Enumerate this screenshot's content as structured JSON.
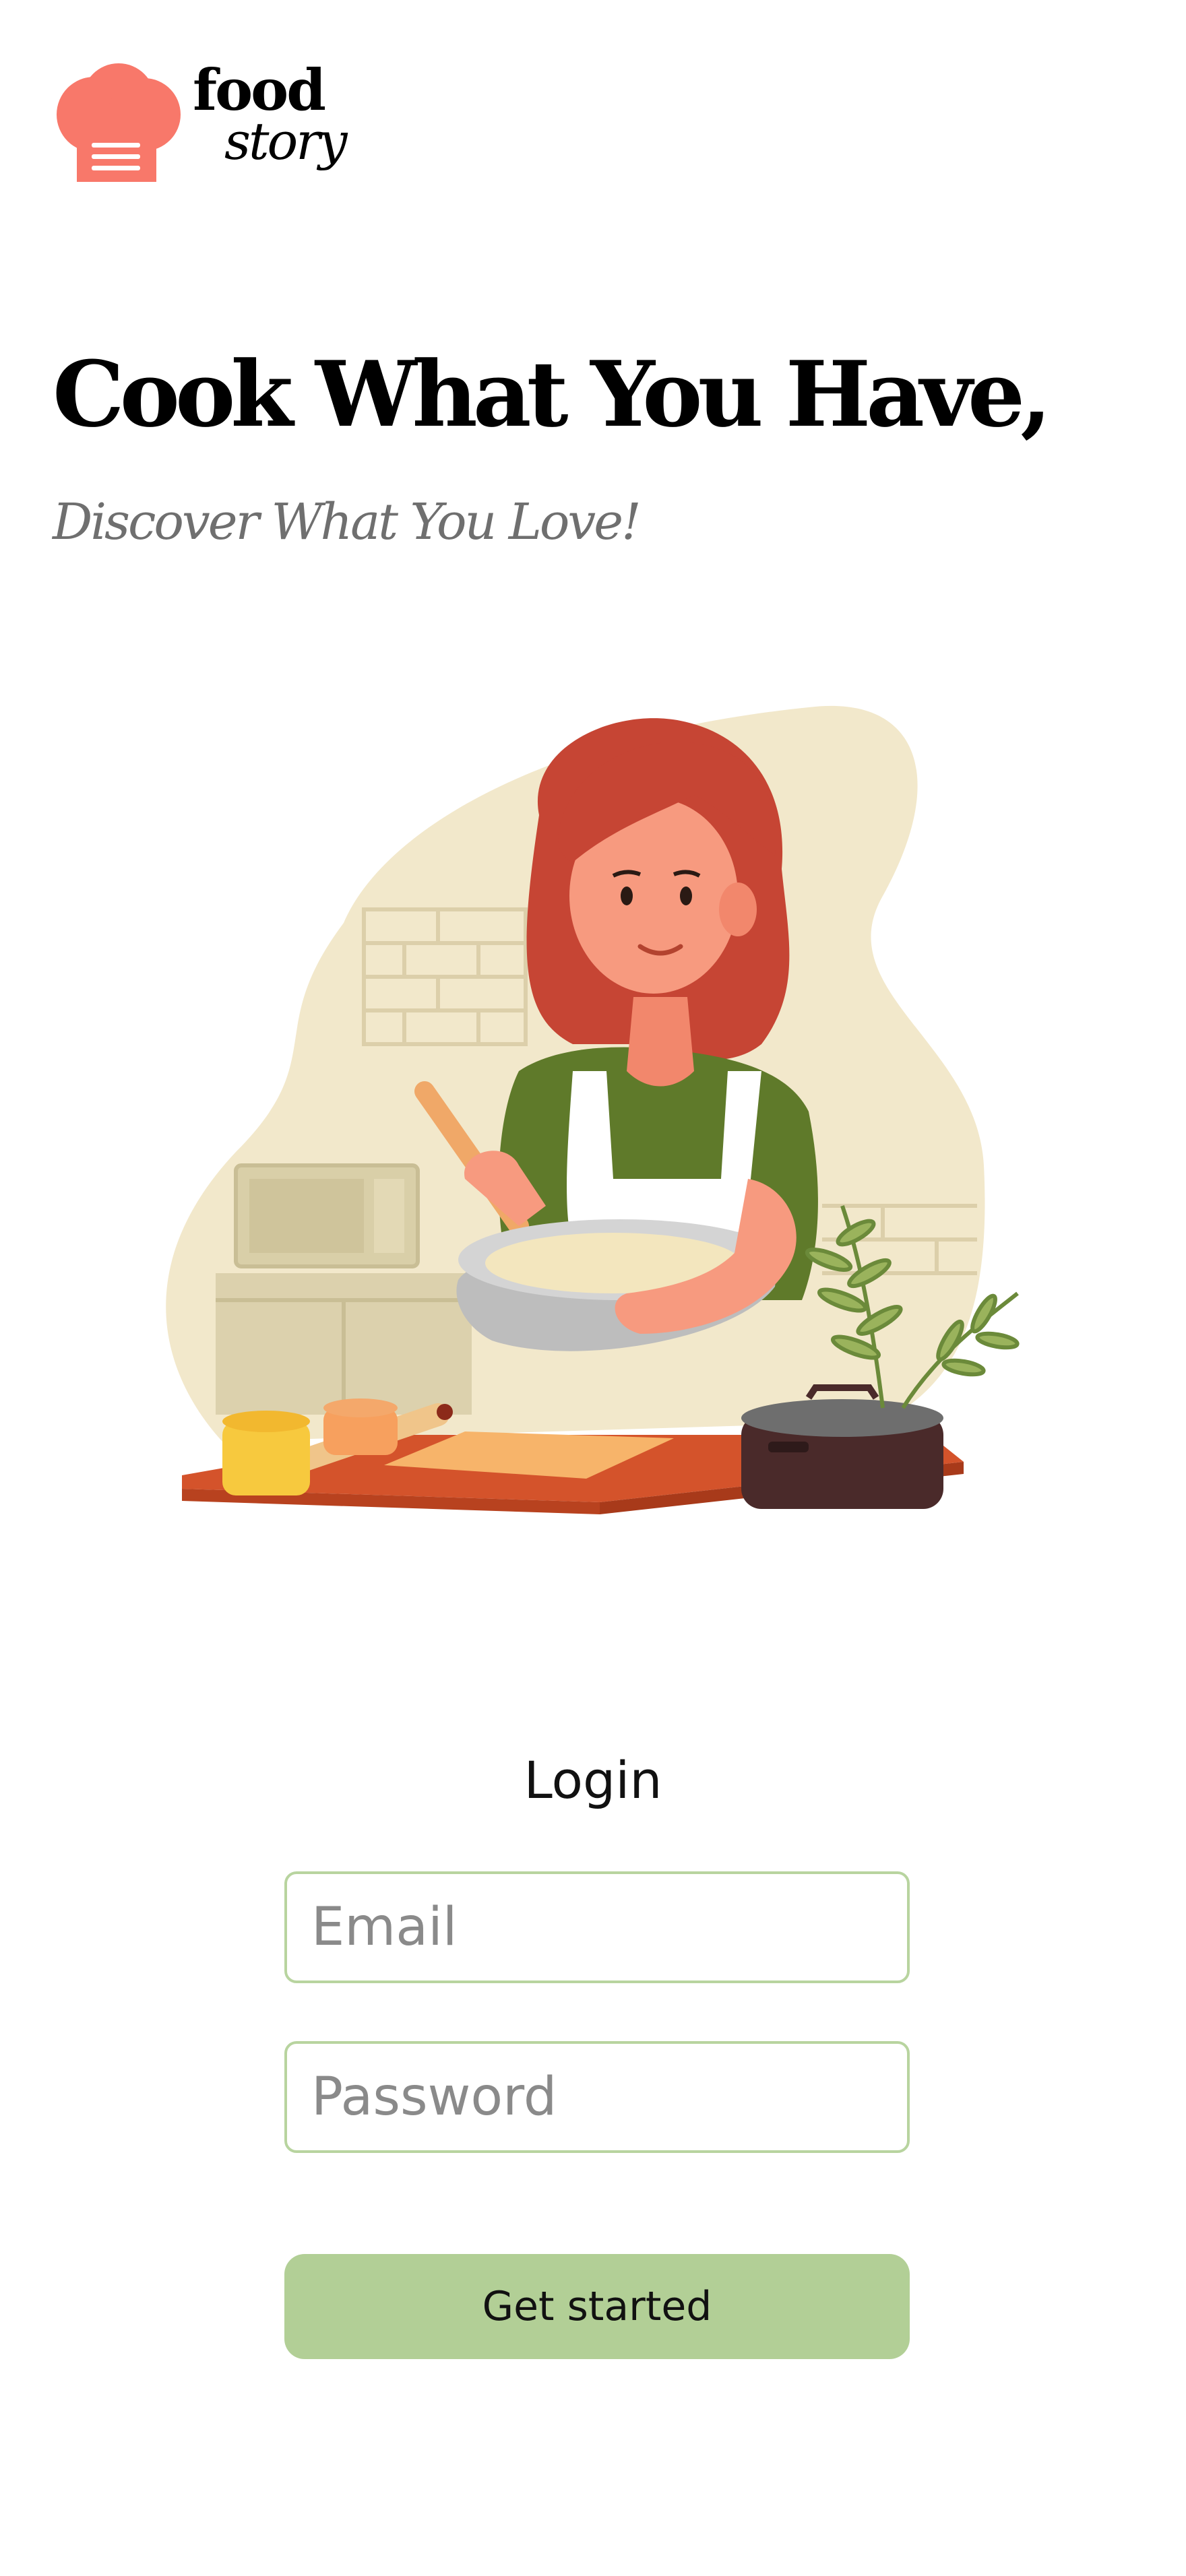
{
  "brand": {
    "line1": "food",
    "line2": "story",
    "accent_color": "#F8786A",
    "menu_icon": "hamburger-menu-icon"
  },
  "hero": {
    "title": "Cook What You Have,",
    "subtitle": "Discover What You Love!"
  },
  "illustration": {
    "icon": "woman-cooking-illustration"
  },
  "login": {
    "heading": "Login",
    "email_placeholder": "Email",
    "password_placeholder": "Password",
    "submit_label": "Get started",
    "button_color": "#B2CF96",
    "field_border_color": "#B8D49F"
  }
}
